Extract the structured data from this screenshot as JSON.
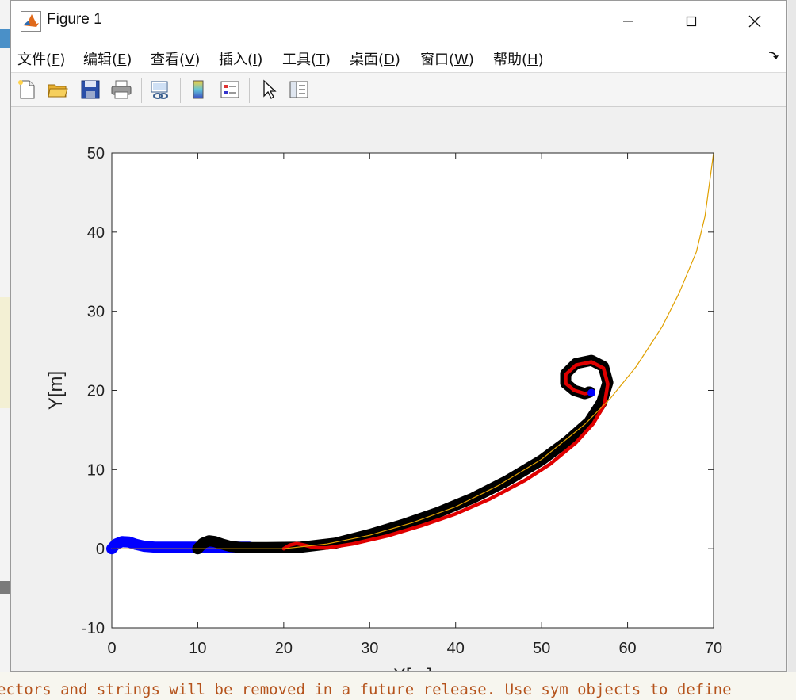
{
  "window": {
    "title": "Figure 1",
    "controls": {
      "minimize": "minimize",
      "maximize": "maximize",
      "close": "close"
    }
  },
  "menu": [
    {
      "label": "文件(",
      "key": "F",
      "tail": ")"
    },
    {
      "label": "编辑(",
      "key": "E",
      "tail": ")"
    },
    {
      "label": "查看(",
      "key": "V",
      "tail": ")"
    },
    {
      "label": "插入(",
      "key": "I",
      "tail": ")"
    },
    {
      "label": "工具(",
      "key": "T",
      "tail": ")"
    },
    {
      "label": "桌面(",
      "key": "D",
      "tail": ")"
    },
    {
      "label": "窗口(",
      "key": "W",
      "tail": ")"
    },
    {
      "label": "帮助(",
      "key": "H",
      "tail": ")"
    }
  ],
  "toolbar": [
    "new-file-icon",
    "open-folder-icon",
    "save-icon",
    "print-icon",
    "link-figure-icon",
    "colorbar-icon",
    "legend-icon",
    "pointer-icon",
    "property-inspector-icon"
  ],
  "background_console_text": "ectors and strings will be removed in a future release. Use sym objects to define",
  "chart_data": {
    "type": "line",
    "xlabel": "X[m]",
    "ylabel": "Y[m]",
    "xlim": [
      0,
      70
    ],
    "ylim": [
      -10,
      50
    ],
    "xticks": [
      0,
      10,
      20,
      30,
      40,
      50,
      60,
      70
    ],
    "yticks": [
      -10,
      0,
      10,
      20,
      30,
      40,
      50
    ],
    "grid": false,
    "series": [
      {
        "color": "#0000ff",
        "width": "thick",
        "x": [
          0,
          0.5,
          1.2,
          2.0,
          2.8,
          3.8,
          5.0,
          6.5,
          8.0,
          10.0,
          12.0,
          14.0,
          16.0
        ],
        "y": [
          0,
          0.6,
          0.9,
          0.85,
          0.55,
          0.3,
          0.2,
          0.2,
          0.2,
          0.2,
          0.2,
          0.2,
          0.2
        ]
      },
      {
        "color": "#000000",
        "width": "thick",
        "x": [
          10,
          10.6,
          11.3,
          12.0,
          12.8,
          13.8,
          15,
          18,
          22,
          26,
          30,
          34,
          38,
          42,
          46,
          50,
          53,
          55.5,
          57,
          57.7,
          57.2,
          55.8,
          54.0,
          52.8,
          52.8,
          53.8,
          55.0,
          55.6,
          55.5
        ],
        "y": [
          0,
          0.7,
          1.0,
          0.9,
          0.6,
          0.3,
          0.15,
          0.15,
          0.2,
          0.7,
          1.8,
          3.1,
          4.6,
          6.4,
          8.6,
          11.2,
          13.6,
          16.0,
          18.5,
          21.0,
          23.0,
          23.8,
          23.4,
          22.1,
          20.9,
          20.0,
          19.6,
          19.8,
          19.8
        ]
      },
      {
        "color": "#e00000",
        "width": "medium",
        "x": [
          20,
          20.7,
          21.5,
          22.4,
          23.5,
          25,
          28,
          32,
          36,
          40,
          44,
          48,
          51,
          54,
          56,
          57.3,
          57.7,
          57.2,
          55.8,
          54.0,
          52.8,
          52.8,
          53.8,
          55.0,
          55.6,
          55.8
        ],
        "y": [
          0,
          0.45,
          0.65,
          0.45,
          0.15,
          0.1,
          0.6,
          1.6,
          2.9,
          4.4,
          6.3,
          8.6,
          10.7,
          13.4,
          15.8,
          18.2,
          20.8,
          22.8,
          23.6,
          23.2,
          22.0,
          20.9,
          20.0,
          19.6,
          19.7,
          19.6
        ]
      },
      {
        "color": "#e0a000",
        "width": "thin",
        "x": [
          0,
          10,
          20,
          25,
          30,
          35,
          40,
          45,
          50,
          55,
          58,
          61,
          64,
          66,
          68,
          69,
          70
        ],
        "y": [
          0,
          0,
          0,
          0.6,
          1.7,
          3.3,
          5.3,
          8.0,
          11.3,
          15.7,
          19.0,
          23.0,
          28.0,
          32.3,
          37.5,
          42.0,
          50.0
        ]
      },
      {
        "color": "#0000ff",
        "width": "marker",
        "x": [
          55.8
        ],
        "y": [
          19.7
        ]
      }
    ]
  }
}
